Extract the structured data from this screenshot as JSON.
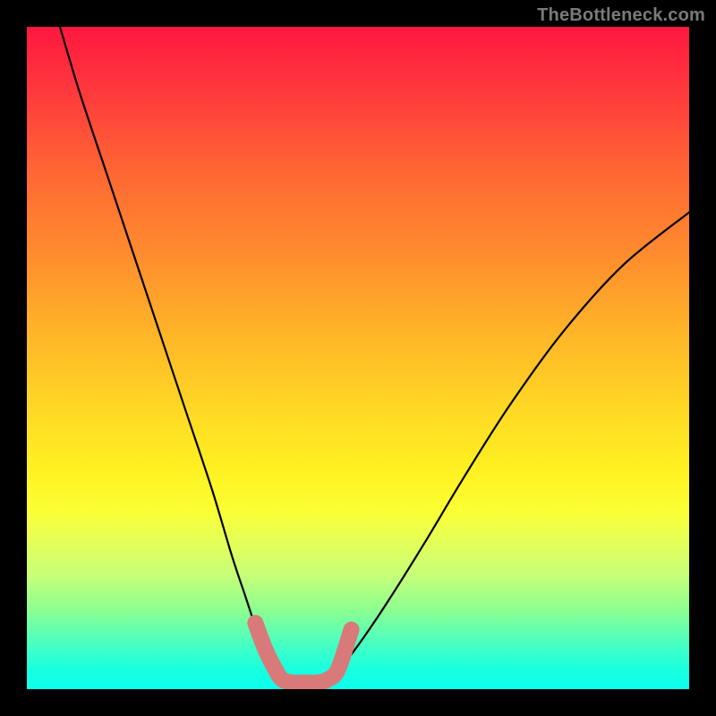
{
  "watermark": "TheBottleneck.com",
  "chart_data": {
    "type": "line",
    "title": "",
    "xlabel": "",
    "ylabel": "",
    "xlim": [
      0,
      100
    ],
    "ylim": [
      0,
      100
    ],
    "series": [
      {
        "name": "left-curve",
        "x": [
          5,
          8,
          12,
          16,
          20,
          24,
          28,
          31,
          33,
          35,
          36.5,
          37.5,
          38
        ],
        "y": [
          100,
          90,
          78,
          66,
          54,
          42,
          30,
          20,
          14,
          8,
          4,
          2,
          1
        ]
      },
      {
        "name": "right-curve",
        "x": [
          45,
          46,
          48,
          51,
          55,
          60,
          66,
          73,
          81,
          90,
          100
        ],
        "y": [
          1,
          2,
          4,
          8,
          14,
          22,
          32,
          43,
          54,
          64,
          72
        ]
      }
    ],
    "annotations": [
      {
        "name": "valley-marker",
        "type": "thick-path",
        "color": "#d87a7a",
        "x": [
          34.5,
          36,
          37.5,
          38.5,
          40,
          42,
          44,
          45.5,
          47,
          49
        ],
        "y": [
          10,
          6,
          3,
          1.5,
          1,
          1,
          1,
          1.5,
          3,
          9
        ]
      }
    ],
    "colors": {
      "curve": "#000000",
      "marker": "#d87a7a",
      "background_top": "#ff173f",
      "background_bottom": "#0affee"
    }
  }
}
